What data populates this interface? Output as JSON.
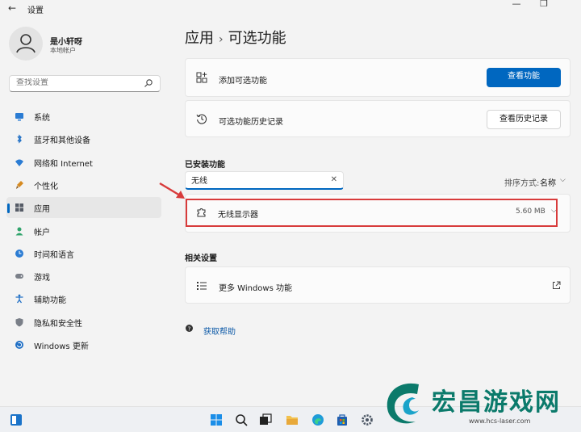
{
  "window": {
    "title": "设置",
    "back_glyph": "←",
    "minimize_glyph": "—",
    "restore_glyph": "❐"
  },
  "user": {
    "name": "是小轩呀",
    "account": "本地帐户"
  },
  "search": {
    "placeholder": "查找设置"
  },
  "sidebar": {
    "items": [
      {
        "label": "系统",
        "icon": "monitor-icon",
        "color": "#2b7cd3"
      },
      {
        "label": "蓝牙和其他设备",
        "icon": "bluetooth-icon",
        "color": "#1f6fc5"
      },
      {
        "label": "网络和 Internet",
        "icon": "wifi-icon",
        "color": "#2b7cd3"
      },
      {
        "label": "个性化",
        "icon": "brush-icon",
        "color": "#d68a20"
      },
      {
        "label": "应用",
        "icon": "apps-icon",
        "color": "#555b66",
        "active": true
      },
      {
        "label": "帐户",
        "icon": "person-icon",
        "color": "#2fa36b"
      },
      {
        "label": "时间和语言",
        "icon": "globe-clock-icon",
        "color": "#2b7cd3"
      },
      {
        "label": "游戏",
        "icon": "gamepad-icon",
        "color": "#7a7f88"
      },
      {
        "label": "辅助功能",
        "icon": "accessibility-icon",
        "color": "#1f6fc5"
      },
      {
        "label": "隐私和安全性",
        "icon": "shield-icon",
        "color": "#7a7f88"
      },
      {
        "label": "Windows 更新",
        "icon": "update-icon",
        "color": "#1f6fc5"
      }
    ]
  },
  "main": {
    "breadcrumb": {
      "parent": "应用",
      "separator": "›",
      "current": "可选功能"
    },
    "add_feature": {
      "label": "添加可选功能",
      "button": "查看功能"
    },
    "history": {
      "label": "可选功能历史记录",
      "button": "查看历史记录"
    },
    "installed": {
      "heading": "已安装功能",
      "filter_value": "无线",
      "clear_glyph": "✕",
      "sort_label": "排序方式:",
      "sort_value": "名称",
      "chevron": "⌵",
      "features": [
        {
          "name": "无线显示器",
          "size": "5.60 MB"
        }
      ]
    },
    "related": {
      "heading": "相关设置",
      "more_windows_features": "更多 Windows 功能"
    },
    "help": "获取帮助"
  },
  "watermark": {
    "text": "宏昌游戏网",
    "url": "www.hcs-laser.com"
  },
  "colors": {
    "accent": "#0067c0",
    "highlight": "#d83b3b",
    "watermark": "#0b7a6b"
  }
}
